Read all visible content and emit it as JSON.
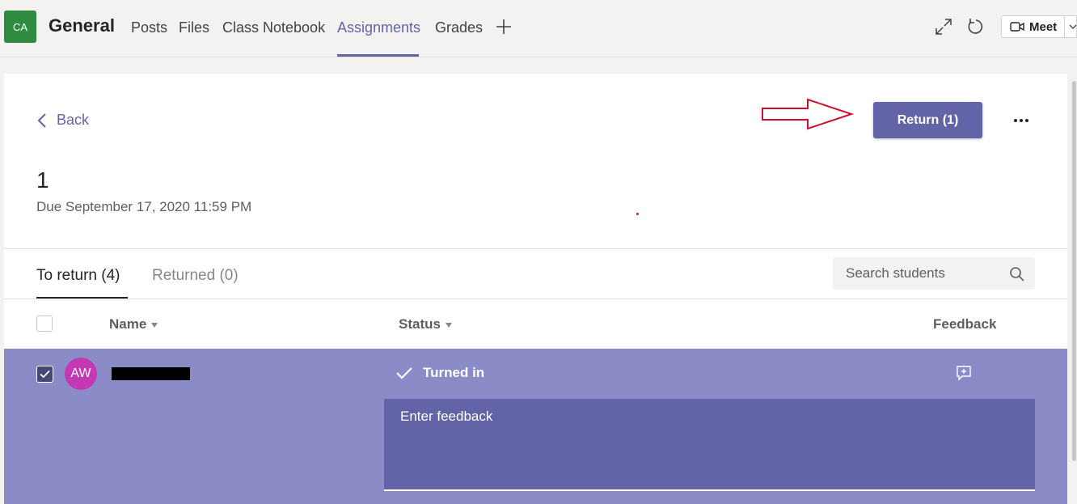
{
  "header": {
    "team_initials": "CA",
    "channel_name": "General",
    "tabs": [
      {
        "label": "Posts"
      },
      {
        "label": "Files"
      },
      {
        "label": "Class Notebook"
      },
      {
        "label": "Assignments",
        "active": true
      },
      {
        "label": "Grades"
      }
    ],
    "add_tab_icon": "plus-icon",
    "expand_icon": "expand-icon",
    "refresh_icon": "refresh-icon",
    "meet_label": "Meet",
    "meet_icon": "video-camera-icon"
  },
  "assignment": {
    "back_label": "Back",
    "return_button_label": "Return (1)",
    "more_icon": "more-options-icon",
    "title": "1",
    "due": "Due September 17, 2020 11:59 PM"
  },
  "annotations": {
    "arrow_color": "#d0102a"
  },
  "subtabs": {
    "to_return": "To return (4)",
    "returned": "Returned (0)"
  },
  "search": {
    "placeholder": "Search students"
  },
  "table": {
    "columns": {
      "name": "Name",
      "status": "Status",
      "feedback": "Feedback"
    },
    "rows": [
      {
        "selected": true,
        "avatar_initials": "AW",
        "status": "Turned in",
        "feedback_placeholder": "Enter feedback"
      }
    ]
  },
  "colors": {
    "brand": "#6264a7",
    "selected_row": "#8b8cc7",
    "team_avatar": "#2e8b3f",
    "student_avatar": "#c239b3"
  }
}
